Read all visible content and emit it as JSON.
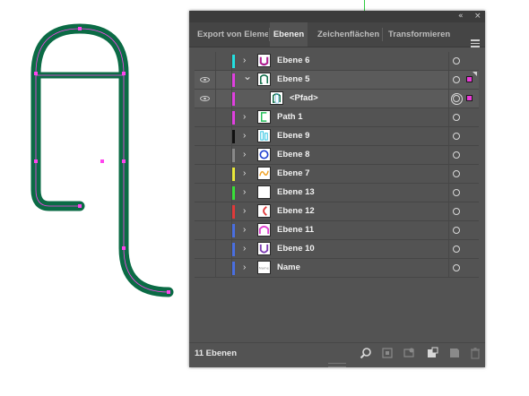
{
  "panel": {
    "collapse_glyph": "«",
    "close_glyph": "×",
    "tabs": [
      {
        "label": "Export von Elemente",
        "active": false
      },
      {
        "label": "Ebenen",
        "active": true
      },
      {
        "label": "Zeichenflächen",
        "active": false
      },
      {
        "label": "Transformieren",
        "active": false
      }
    ],
    "layers": [
      {
        "name": "Ebene 6",
        "color": "#23e0e0",
        "visible": false,
        "expanded": false,
        "thumb": "frame-red-u"
      },
      {
        "name": "Ebene 5",
        "color": "#e040e0",
        "visible": true,
        "expanded": true,
        "thumb": "frame-green-hook",
        "selected_art": true
      },
      {
        "name": "<Pfad>",
        "color": "#e040e0",
        "visible": true,
        "child": true,
        "thumb": "green-hook",
        "selected_art": true
      },
      {
        "name": "Path 1",
        "color": "#e040e0",
        "visible": false,
        "expanded": false,
        "thumb": "green-bracket"
      },
      {
        "name": "Ebene 9",
        "color": "#111111",
        "visible": false,
        "expanded": false,
        "thumb": "cyan-bars"
      },
      {
        "name": "Ebene 8",
        "color": "#888888",
        "visible": false,
        "expanded": false,
        "thumb": "blue-circle"
      },
      {
        "name": "Ebene 7",
        "color": "#e8e83a",
        "visible": false,
        "expanded": false,
        "thumb": "orange-wave"
      },
      {
        "name": "Ebene 13",
        "color": "#39e039",
        "visible": false,
        "expanded": false,
        "thumb": "blank"
      },
      {
        "name": "Ebene 12",
        "color": "#e03a3a",
        "visible": false,
        "expanded": false,
        "thumb": "red-arc"
      },
      {
        "name": "Ebene 11",
        "color": "#4a6fe0",
        "visible": false,
        "expanded": false,
        "thumb": "magenta-arch"
      },
      {
        "name": "Ebene 10",
        "color": "#4a6fe0",
        "visible": false,
        "expanded": false,
        "thumb": "purple-u"
      },
      {
        "name": "Name",
        "color": "#4a6fe0",
        "visible": false,
        "expanded": false,
        "thumb": "text-name"
      }
    ],
    "footer": {
      "count_label": "11 Ebenen",
      "icons": [
        "search-icon",
        "collect-icon",
        "clip-mask-icon",
        "new-sublayer-icon",
        "new-layer-icon",
        "trash-icon"
      ]
    }
  },
  "accent_colors": {
    "path_stroke": "#0b6b45",
    "path_highlight": "#ff44ee",
    "guide": "#2ecc40"
  }
}
